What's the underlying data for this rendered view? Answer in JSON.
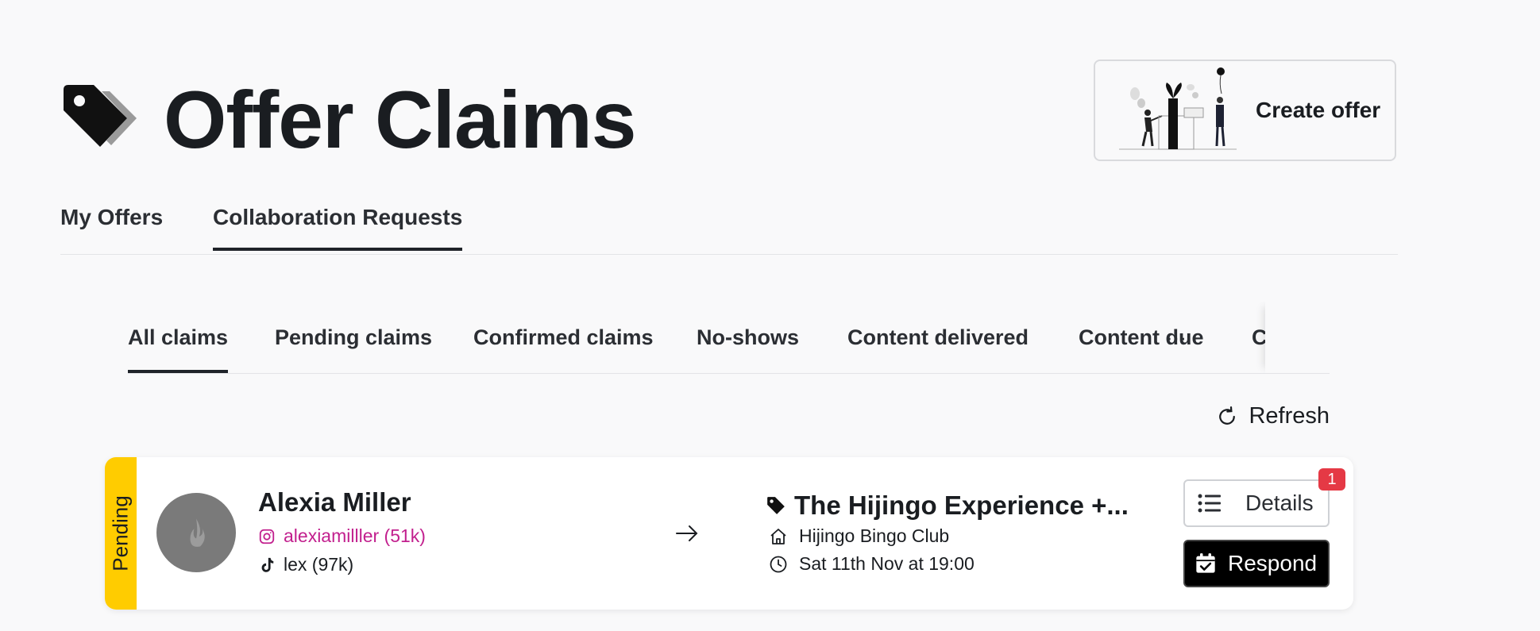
{
  "header": {
    "title": "Offer Claims",
    "create_offer_label": "Create offer"
  },
  "main_tabs": [
    {
      "label": "My Offers",
      "active": false
    },
    {
      "label": "Collaboration Requests",
      "active": true
    }
  ],
  "sub_tabs": [
    {
      "label": "All claims",
      "active": true
    },
    {
      "label": "Pending claims",
      "active": false
    },
    {
      "label": "Confirmed claims",
      "active": false
    },
    {
      "label": "No-shows",
      "active": false
    },
    {
      "label": "Content delivered",
      "active": false
    },
    {
      "label": "Content due",
      "active": false
    },
    {
      "label": "C",
      "active": false
    }
  ],
  "more_label": "···",
  "refresh_label": "Refresh",
  "claim": {
    "status": "Pending",
    "status_color": "#ffcc00",
    "influencer": {
      "name": "Alexia Miller",
      "instagram": "alexiamilller (51k)",
      "tiktok": "lex (97k)"
    },
    "offer": {
      "title": "The Hijingo Experience +...",
      "venue": "Hijingo Bingo Club",
      "datetime": "Sat 11th Nov at 19:00"
    },
    "details_label": "Details",
    "details_badge": "1",
    "respond_label": "Respond"
  },
  "colors": {
    "accent_pink": "#c2208e",
    "badge_red": "#e53945",
    "pending_yellow": "#ffcc00"
  },
  "icons": [
    "tag-icon",
    "refresh-icon",
    "instagram-icon",
    "tiktok-icon",
    "arrow-right-icon",
    "home-icon",
    "clock-icon",
    "list-icon",
    "calendar-check-icon"
  ]
}
